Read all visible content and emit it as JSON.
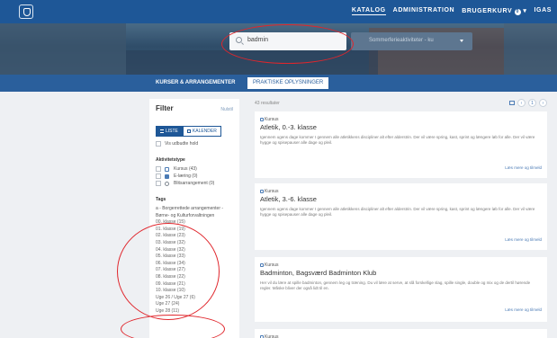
{
  "nav": {
    "items": [
      "KATALOG",
      "ADMINISTRATION",
      "BRUGERKURV",
      "IGAS"
    ],
    "cart_badge": "0"
  },
  "search": {
    "value": "badmin",
    "select_placeholder": "Sommerferieaktiviteter - ku"
  },
  "tabs": [
    "KURSER & ARRANGEMENTER",
    "PRAKTISKE OPLYSNINGER"
  ],
  "filter": {
    "title": "Filter",
    "reset": "Nulstil",
    "view_list": "LISTE",
    "view_calendar": "KALENDER",
    "show_completed": "Vis udbudte hold",
    "activity_type_heading": "Aktivitetstype",
    "activity_types": [
      {
        "label": "Kursus (43)"
      },
      {
        "label": "E-læring (0)"
      },
      {
        "label": "Blitsarrangement (0)"
      }
    ],
    "tags_heading": "Tags",
    "tags_first": "a - Borgerrettede arrangementer - Børne- og Kulturforvaltningen",
    "tags": [
      "00. klasse (15)",
      "01. klasse (19)",
      "02. klasse (23)",
      "03. klasse (32)",
      "04. klasse (32)",
      "05. klasse (33)",
      "06. klasse (34)",
      "07. klasse (27)",
      "08. klasse (22)",
      "09. klasse (21)",
      "10. klasse (10)",
      "Uge 26 / Uge 27 (6)",
      "Uge 27 (24)",
      "Uge 28 (11)"
    ]
  },
  "results": {
    "count": "43 resultater",
    "page": "1",
    "cards": [
      {
        "type": "Kursus",
        "title": "Atletik, 0.-3. klasse",
        "desc": "Igennem ugens dage kommer I gennem alle atletikkens discipliner alt efter alderstrin. Der vil være spring, kast, sprint og længere løb for alle. Der vil være hygge og spisepauser alle dage og pleil.",
        "more": "Læs mere og tilmeld"
      },
      {
        "type": "Kursus",
        "title": "Atletik, 3.-6. klasse",
        "desc": "Igennem ugens dage kommer I gennem alle atletikkens discipliner alt efter alderstrin. Der vil være spring, kast, sprint og længere løb for alle. Der vil være hygge og spisepauser alle dage og pleil.",
        "more": "Læs mere og tilmeld"
      },
      {
        "type": "Kursus",
        "title": "Badminton, Bagsværd Badminton Klub",
        "desc": "Her vil du lære at spille badminton, gennem leg og træning. Du vil lære at serve, at slå forskellige slag, spille single, double og mix og de dertil hørende regler. Måske bliver der også lidt til en.",
        "more": "Læs mere og tilmeld"
      },
      {
        "type": "Kursus"
      }
    ]
  },
  "colors": {
    "nav_bg": "#1e5797",
    "tabstrip_bg": "#2a5f9c",
    "accent": "#4b7bb5",
    "annotation": "#e0262c"
  }
}
